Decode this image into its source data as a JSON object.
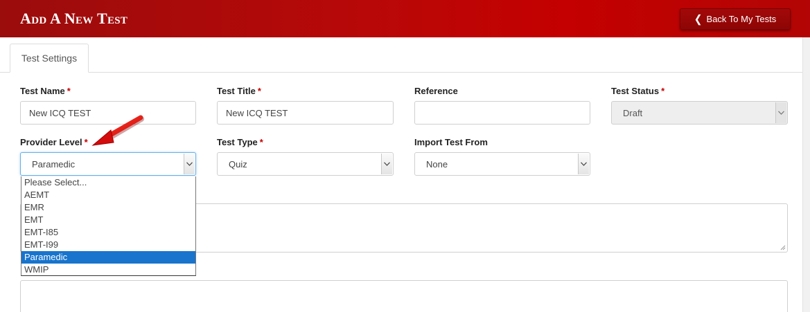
{
  "header": {
    "title": "Add A New Test",
    "back_label": "Back To My Tests"
  },
  "tabs": [
    {
      "label": "Test Settings"
    }
  ],
  "form": {
    "test_name": {
      "label": "Test Name",
      "value": "New ICQ TEST"
    },
    "test_title": {
      "label": "Test Title",
      "value": "New ICQ TEST"
    },
    "reference": {
      "label": "Reference",
      "value": ""
    },
    "test_status": {
      "label": "Test Status",
      "value": "Draft"
    },
    "provider_level": {
      "label": "Provider Level",
      "value": "Paramedic"
    },
    "test_type": {
      "label": "Test Type",
      "value": "Quiz"
    },
    "import_from": {
      "label": "Import Test From",
      "value": "None"
    },
    "required_mark": "*"
  },
  "provider_options": [
    "Please Select...",
    "AEMT",
    "EMR",
    "EMT",
    "EMT-I85",
    "EMT-I99",
    "Paramedic",
    "WMIP"
  ],
  "colors": {
    "header_red": "#b80808",
    "required_red": "#c40000",
    "selection_blue": "#1874cd",
    "annotation_arrow": "#e01010"
  },
  "icons": {
    "back": "chevron-left-icon",
    "select": "chevron-down-icon",
    "annotation": "red-arrow-icon"
  }
}
